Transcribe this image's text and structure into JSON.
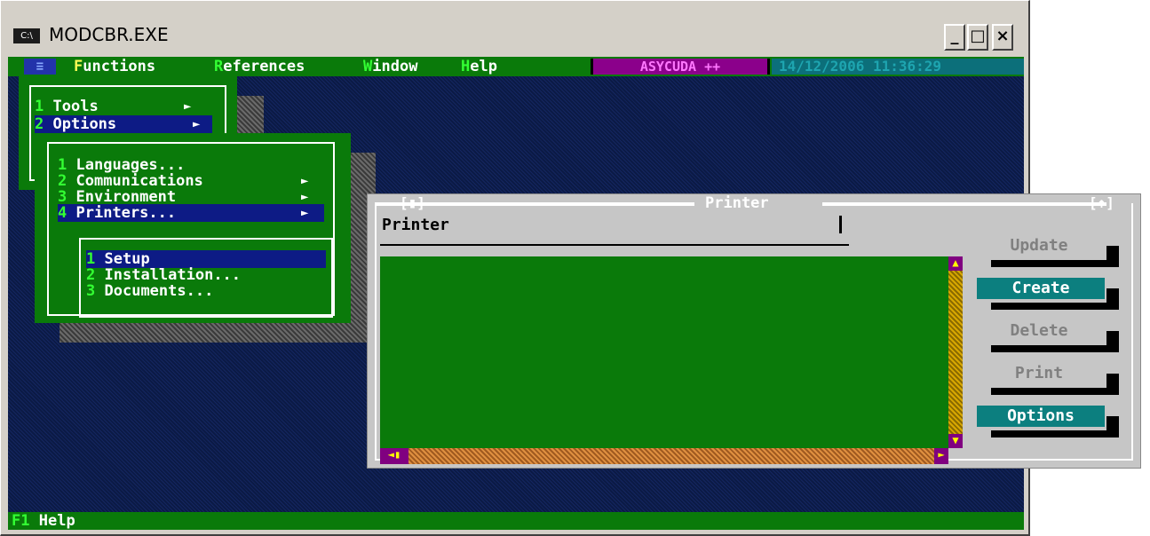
{
  "window": {
    "title": "MODCBR.EXE",
    "icon_text": "C:\\",
    "min": "_",
    "max": "□",
    "close": "×"
  },
  "menubar": {
    "menu_icon": "≡",
    "items": [
      {
        "hot": "F",
        "rest": "unctions"
      },
      {
        "hot": "R",
        "rest": "eferences"
      },
      {
        "hot": "W",
        "rest": "indow"
      },
      {
        "hot": "H",
        "rest": "elp"
      }
    ],
    "badge": "ASYCUDA ++",
    "datetime": "14/12/2006 11:36:29"
  },
  "menu_functions": {
    "items": [
      {
        "num": "1",
        "label": "Tools"
      },
      {
        "num": "2",
        "label": "Options"
      }
    ]
  },
  "menu_options": {
    "items": [
      {
        "num": "1",
        "label": "Languages..."
      },
      {
        "num": "2",
        "label": "Communications"
      },
      {
        "num": "3",
        "label": "Environment"
      },
      {
        "num": "4",
        "label": "Printers..."
      }
    ]
  },
  "menu_printers": {
    "items": [
      {
        "num": "1",
        "label": "Setup"
      },
      {
        "num": "2",
        "label": "Installation..."
      },
      {
        "num": "3",
        "label": "Documents..."
      }
    ]
  },
  "dialog": {
    "title": "Printer",
    "close_marker": "[▮]",
    "max_marker": "[↑]",
    "column_header": "Printer",
    "buttons": {
      "update": "Update",
      "create": "Create",
      "delete": "Delete",
      "print": "Print",
      "options": "Options"
    }
  },
  "statusbar": {
    "key": "F1",
    "label": "Help"
  },
  "colors": {
    "menu_green": "#0a7a0a",
    "desktop_blue": "#0b1a45",
    "selection_blue": "#0d1b85",
    "badge_purple": "#8b008b",
    "datetime_teal": "#0c6f7a",
    "dialog_gray": "#c6c6c6"
  }
}
